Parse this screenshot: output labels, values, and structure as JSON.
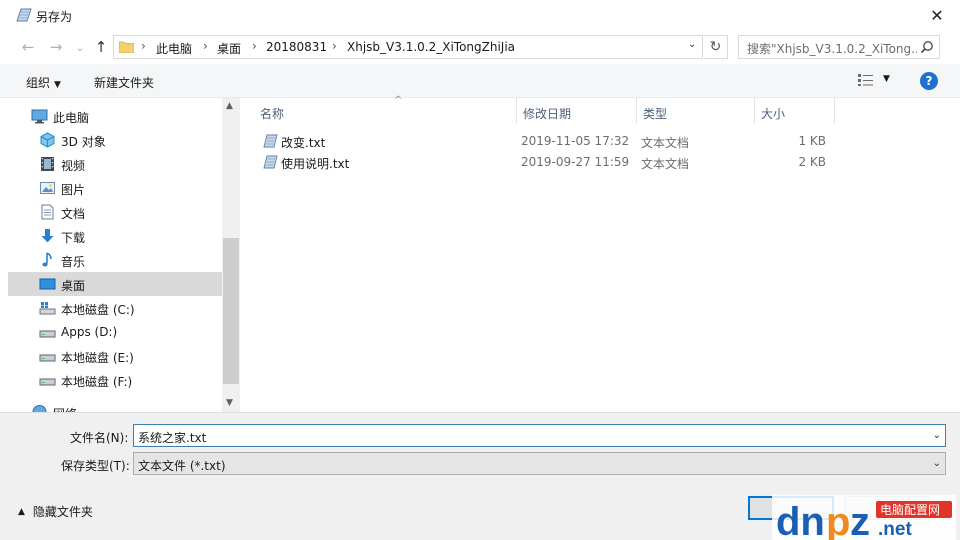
{
  "window": {
    "title": "另存为",
    "close_glyph": "✕"
  },
  "nav": {
    "back_glyph": "←",
    "forward_glyph": "→",
    "recent_glyph": "⌄",
    "up_glyph": "↑",
    "breadcrumb": [
      "此电脑",
      "桌面",
      "20180831",
      "Xhjsb_V3.1.0.2_XiTongZhiJia"
    ],
    "separator": "›",
    "dropdown_glyph": "⌄",
    "refresh_glyph": "↻",
    "search_placeholder": "搜索\"Xhjsb_V3.1.0.2_XiTong..."
  },
  "toolbar": {
    "organize": "组织",
    "new_folder": "新建文件夹",
    "caret_glyph": "▼",
    "help_glyph": "?"
  },
  "sidebar": {
    "items": [
      {
        "label": "此电脑",
        "icon": "computer-icon"
      },
      {
        "label": "3D 对象",
        "icon": "3d-objects-icon"
      },
      {
        "label": "视频",
        "icon": "video-icon"
      },
      {
        "label": "图片",
        "icon": "pictures-icon"
      },
      {
        "label": "文档",
        "icon": "documents-icon"
      },
      {
        "label": "下载",
        "icon": "download-icon"
      },
      {
        "label": "音乐",
        "icon": "music-icon"
      },
      {
        "label": "桌面",
        "icon": "desktop-icon",
        "selected": true
      },
      {
        "label": "本地磁盘 (C:)",
        "icon": "system-drive-icon"
      },
      {
        "label": "Apps (D:)",
        "icon": "drive-icon"
      },
      {
        "label": "本地磁盘 (E:)",
        "icon": "drive-icon"
      },
      {
        "label": "本地磁盘 (F:)",
        "icon": "drive-icon"
      },
      {
        "label": "网络",
        "icon": "network-icon"
      }
    ],
    "scroll_up_glyph": "▲",
    "scroll_down_glyph": "▼"
  },
  "columns": {
    "name": "名称",
    "date": "修改日期",
    "type": "类型",
    "size": "大小",
    "sort_glyph": "^"
  },
  "files": [
    {
      "name": "改变.txt",
      "date": "2019-11-05 17:32",
      "type": "文本文档",
      "size": "1 KB"
    },
    {
      "name": "使用说明.txt",
      "date": "2019-09-27 11:59",
      "type": "文本文档",
      "size": "2 KB"
    }
  ],
  "form": {
    "filename_label": "文件名(N):",
    "filename_value": "系统之家.txt",
    "filetype_label": "保存类型(T):",
    "filetype_value": "文本文件 (*.txt)",
    "dropdown_glyph": "⌄"
  },
  "footer": {
    "hide_folders": "隐藏文件夹",
    "hide_caret_glyph": "▲"
  },
  "watermark": {
    "brand": "dnpz.net",
    "badge": "电脑配置网"
  },
  "colors": {
    "accent": "#0078d7",
    "selected_bg": "#d9d9d9",
    "help_blue": "#1f6fcf",
    "watermark_blue": "#1a5fb4",
    "watermark_orange": "#f08a1c"
  }
}
